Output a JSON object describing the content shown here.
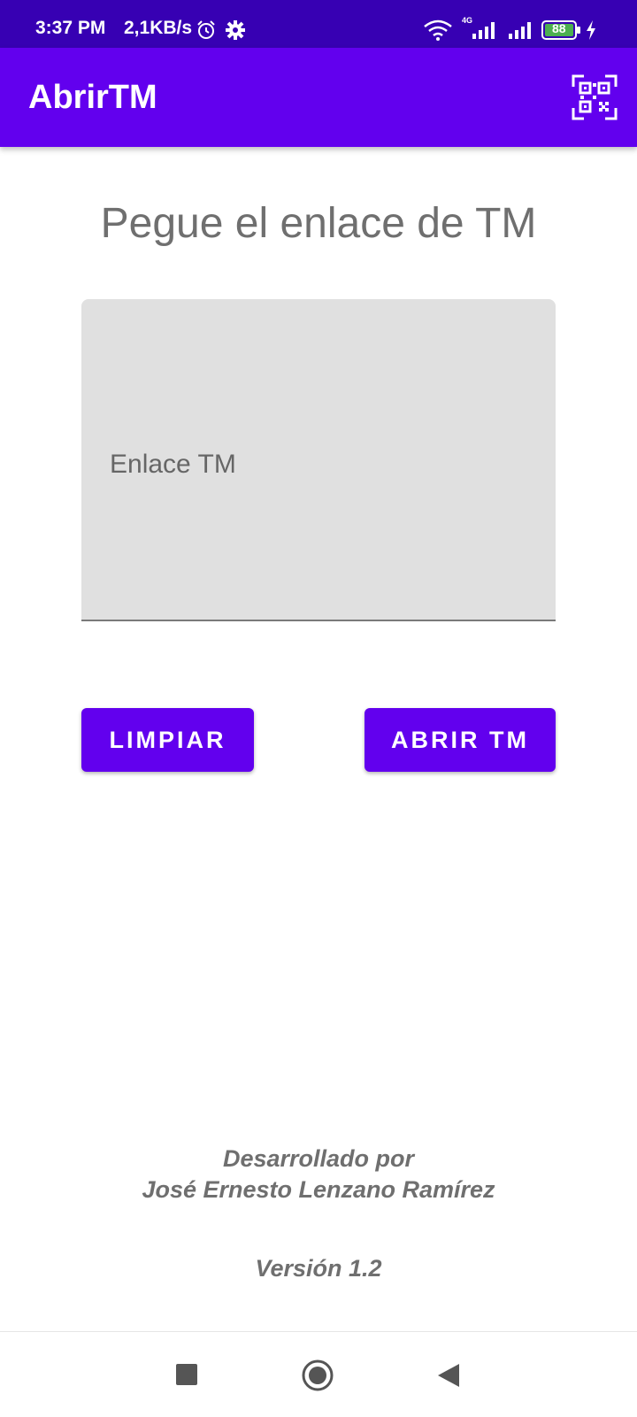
{
  "status_bar": {
    "time": "3:37 PM",
    "speed": "2,1KB/s",
    "battery": "88",
    "network": "4G",
    "icons": [
      "alarm-icon",
      "gear-icon",
      "wifi-icon",
      "signal-icon",
      "battery-icon",
      "charging-icon"
    ]
  },
  "app_bar": {
    "title": "AbrirTM",
    "action_icon": "qr-code-icon"
  },
  "main": {
    "heading": "Pegue el enlace de TM",
    "link_field": {
      "placeholder": "Enlace TM",
      "value": ""
    },
    "buttons": {
      "clear": "LIMPIAR",
      "open": "ABRIR TM"
    }
  },
  "footer": {
    "developed_by": "Desarrollado por",
    "author": "José Ernesto Lenzano Ramírez",
    "version": "Versión 1.2"
  },
  "nav_bar": {
    "icons": [
      "recent-apps-icon",
      "home-icon",
      "back-icon"
    ]
  },
  "colors": {
    "status_bar": "#3700b3",
    "primary": "#6200ee",
    "field_background": "#e0e0e0",
    "text_gray": "#6f6f6f"
  }
}
